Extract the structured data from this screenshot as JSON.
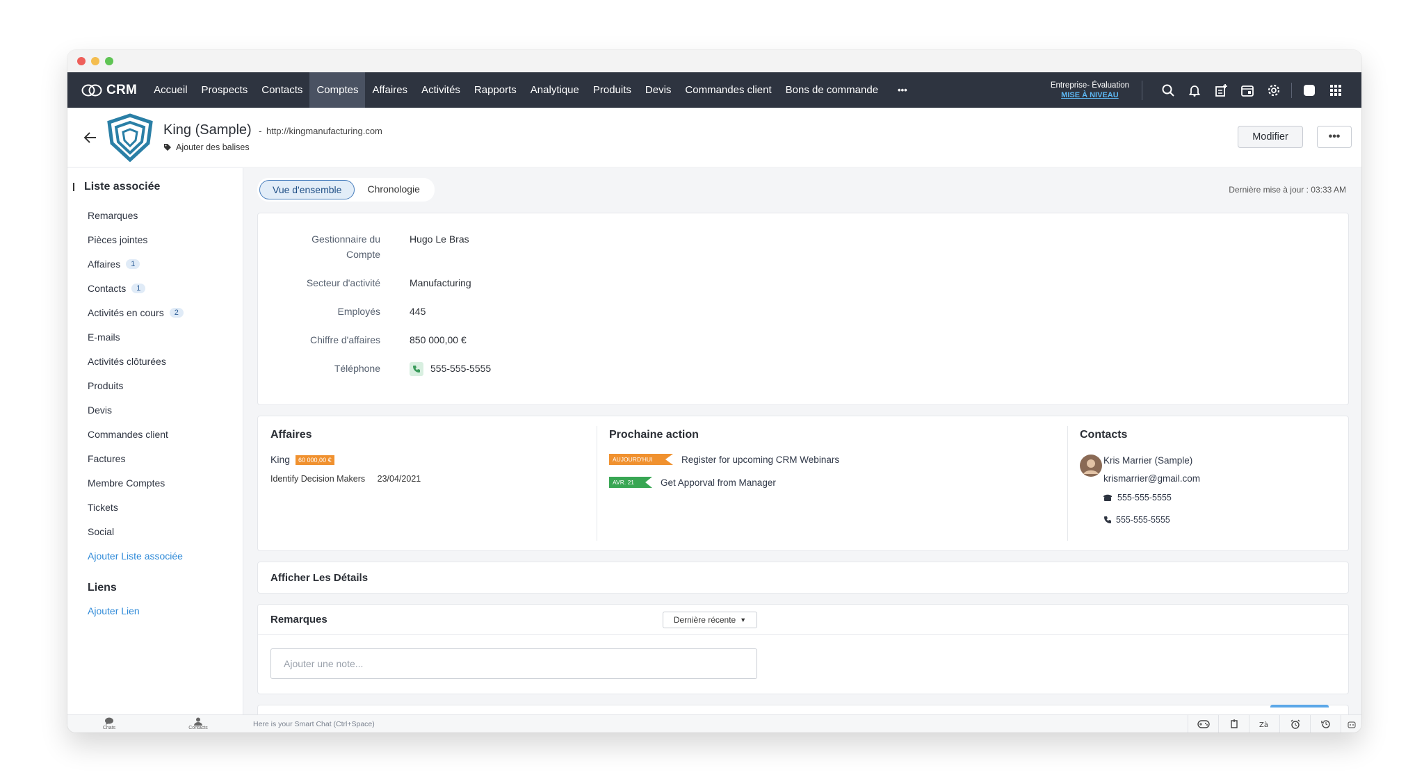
{
  "nav": {
    "brand": "CRM",
    "tabs": [
      "Accueil",
      "Prospects",
      "Contacts",
      "Comptes",
      "Affaires",
      "Activités",
      "Rapports",
      "Analytique",
      "Produits",
      "Devis",
      "Commandes client",
      "Bons de commande"
    ],
    "active_tab": "Comptes",
    "more": "•••",
    "edition": "Entreprise- Évaluation",
    "upgrade": "MISE À NIVEAU"
  },
  "record": {
    "name": "King (Sample)",
    "separator": "-",
    "url": "http://kingmanufacturing.com",
    "tags_link": "Ajouter des balises",
    "edit_button": "Modifier",
    "more_button": "•••"
  },
  "sidebar": {
    "header": "Liste associée",
    "items": [
      {
        "label": "Remarques",
        "count": null
      },
      {
        "label": "Pièces jointes",
        "count": null
      },
      {
        "label": "Affaires",
        "count": "1"
      },
      {
        "label": "Contacts",
        "count": "1"
      },
      {
        "label": "Activités en cours",
        "count": "2"
      },
      {
        "label": "E-mails",
        "count": null
      },
      {
        "label": "Activités clôturées",
        "count": null
      },
      {
        "label": "Produits",
        "count": null
      },
      {
        "label": "Devis",
        "count": null
      },
      {
        "label": "Commandes client",
        "count": null
      },
      {
        "label": "Factures",
        "count": null
      },
      {
        "label": "Membre Comptes",
        "count": null
      },
      {
        "label": "Tickets",
        "count": null
      },
      {
        "label": "Social",
        "count": null
      }
    ],
    "add_related": "Ajouter Liste associée",
    "links_header": "Liens",
    "add_link": "Ajouter Lien"
  },
  "main": {
    "tabs": [
      "Vue d'ensemble",
      "Chronologie"
    ],
    "last_updated": "Dernière mise à jour : 03:33 AM",
    "fields": [
      {
        "label": "Gestionnaire du Compte",
        "value": "Hugo Le Bras"
      },
      {
        "label": "Secteur d'activité",
        "value": "Manufacturing"
      },
      {
        "label": "Employés",
        "value": "445"
      },
      {
        "label": "Chiffre d'affaires",
        "value": "850 000,00 €"
      },
      {
        "label": "Téléphone",
        "value": "555-555-5555"
      }
    ],
    "deals": {
      "title": "Affaires",
      "name": "King",
      "amount": "60 000,00 €",
      "stage": "Identify Decision Makers",
      "date": "23/04/2021"
    },
    "next_action": {
      "title": "Prochaine action",
      "items": [
        {
          "tag": "AUJOURD'HUI",
          "text": "Register for upcoming CRM Webinars",
          "color": "#f0912f"
        },
        {
          "tag": "AVR. 21",
          "text": "Get Apporval from Manager",
          "color": "#38a653"
        }
      ]
    },
    "contacts": {
      "title": "Contacts",
      "name": "Kris Marrier (Sample)",
      "email": "krismarrier@gmail.com",
      "phone": "555-555-5555",
      "mobile": "555-555-5555"
    },
    "details_title": "Afficher Les Détails",
    "notes": {
      "title": "Remarques",
      "sort": "Dernière récente",
      "placeholder": "Ajouter une note..."
    }
  },
  "bottombar": {
    "chats": "Chats",
    "contacts": "Contacts",
    "smart_chat": "Here is your Smart Chat (Ctrl+Space)"
  },
  "colors": {
    "nav_bg": "#2e3440",
    "accent": "#2f8ad8",
    "today_tag": "#f0912f",
    "date_tag": "#38a653",
    "deal_amount_tag": "#f0912f"
  }
}
